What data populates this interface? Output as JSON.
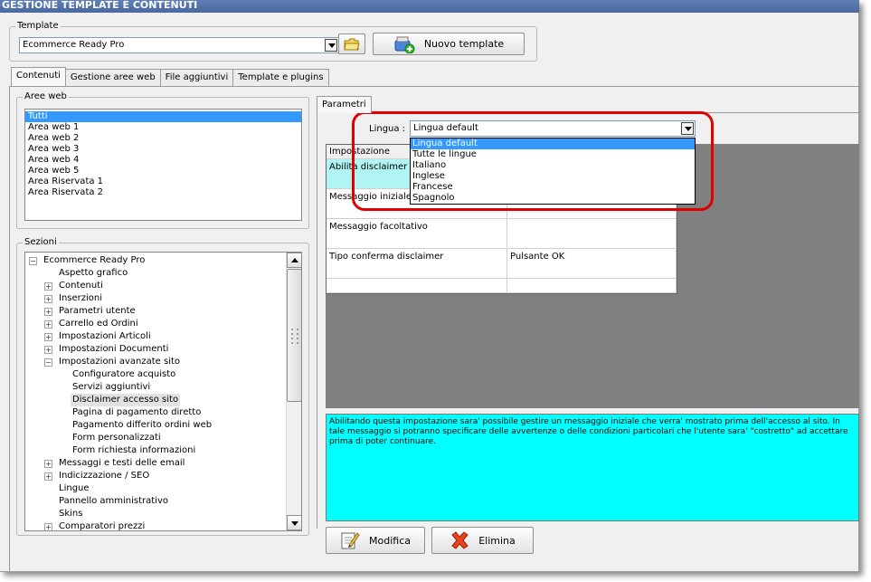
{
  "window": {
    "title": "GESTIONE TEMPLATE E CONTENUTI"
  },
  "template_group": {
    "label": "Template",
    "selected": "Ecommerce Ready Pro",
    "new_button": "Nuovo template"
  },
  "tabs": [
    {
      "label": "Contenuti",
      "active": true
    },
    {
      "label": "Gestione aree web",
      "active": false
    },
    {
      "label": "File aggiuntivi",
      "active": false
    },
    {
      "label": "Template e plugins",
      "active": false
    }
  ],
  "aree_web": {
    "label": "Aree web",
    "items": [
      "Tutti",
      "Area web 1",
      "Area web 2",
      "Area web 3",
      "Area web 4",
      "Area web 5",
      "Area Riservata 1",
      "Area Riservata 2"
    ],
    "selected": "Tutti"
  },
  "sezioni": {
    "label": "Sezioni",
    "root": "Ecommerce Ready Pro",
    "items": [
      {
        "label": "Aspetto grafico",
        "level": 1,
        "expander": ""
      },
      {
        "label": "Contenuti",
        "level": 1,
        "expander": "+"
      },
      {
        "label": "Inserzioni",
        "level": 1,
        "expander": "+"
      },
      {
        "label": "Parametri utente",
        "level": 1,
        "expander": "+"
      },
      {
        "label": "Carrello ed Ordini",
        "level": 1,
        "expander": "+"
      },
      {
        "label": "Impostazioni Articoli",
        "level": 1,
        "expander": "+"
      },
      {
        "label": "Impostazioni Documenti",
        "level": 1,
        "expander": "+"
      },
      {
        "label": "Impostazioni avanzate sito",
        "level": 1,
        "expander": "-"
      },
      {
        "label": "Configuratore acquisto",
        "level": 2,
        "expander": ""
      },
      {
        "label": "Servizi aggiuntivi",
        "level": 2,
        "expander": ""
      },
      {
        "label": "Disclaimer accesso sito",
        "level": 2,
        "expander": "",
        "selected": true
      },
      {
        "label": "Pagina di pagamento diretto",
        "level": 2,
        "expander": ""
      },
      {
        "label": "Pagamento differito ordini web",
        "level": 2,
        "expander": ""
      },
      {
        "label": "Form personalizzati",
        "level": 2,
        "expander": ""
      },
      {
        "label": "Form richiesta informazioni",
        "level": 2,
        "expander": ""
      },
      {
        "label": "Messaggi e testi delle email",
        "level": 1,
        "expander": "+"
      },
      {
        "label": "Indicizzazione / SEO",
        "level": 1,
        "expander": "+"
      },
      {
        "label": "Lingue",
        "level": 1,
        "expander": ""
      },
      {
        "label": "Pannello amministrativo",
        "level": 1,
        "expander": ""
      },
      {
        "label": "Skins",
        "level": 1,
        "expander": ""
      },
      {
        "label": "Comparatori prezzi",
        "level": 1,
        "expander": "+"
      }
    ]
  },
  "parametri": {
    "tab_label": "Parametri",
    "lingua_label": "Lingua :",
    "lingua_selected": "Lingua default",
    "lingua_options": [
      "Lingua default",
      "Tutte le lingue",
      "Italiano",
      "Inglese",
      "Francese",
      "Spagnolo"
    ],
    "grid_header": "Impostazione",
    "rows": [
      {
        "name": "Abilita disclaimer iniziale",
        "value": ""
      },
      {
        "name": "Messaggio iniziale",
        "value": ""
      },
      {
        "name": "Messaggio facoltativo",
        "value": ""
      },
      {
        "name": "Tipo conferma disclaimer",
        "value": "Pulsante OK"
      },
      {
        "name": "",
        "value": ""
      }
    ],
    "info_text": "Abilitando questa impostazione sara' possibile gestire un messaggio iniziale che verra' mostrato prima dell'accesso al sito. In tale messaggio si potranno specificare delle avvertenze o delle condizioni particolari che l'utente sara' \"costretto\" ad accettare prima di poter continuare.",
    "modifica_button": "Modifica",
    "elimina_button": "Elimina"
  },
  "colors": {
    "accent": "#3399ff",
    "info_background": "#00ffff",
    "highlight_ring": "#e00000",
    "grid_background": "#808080"
  }
}
